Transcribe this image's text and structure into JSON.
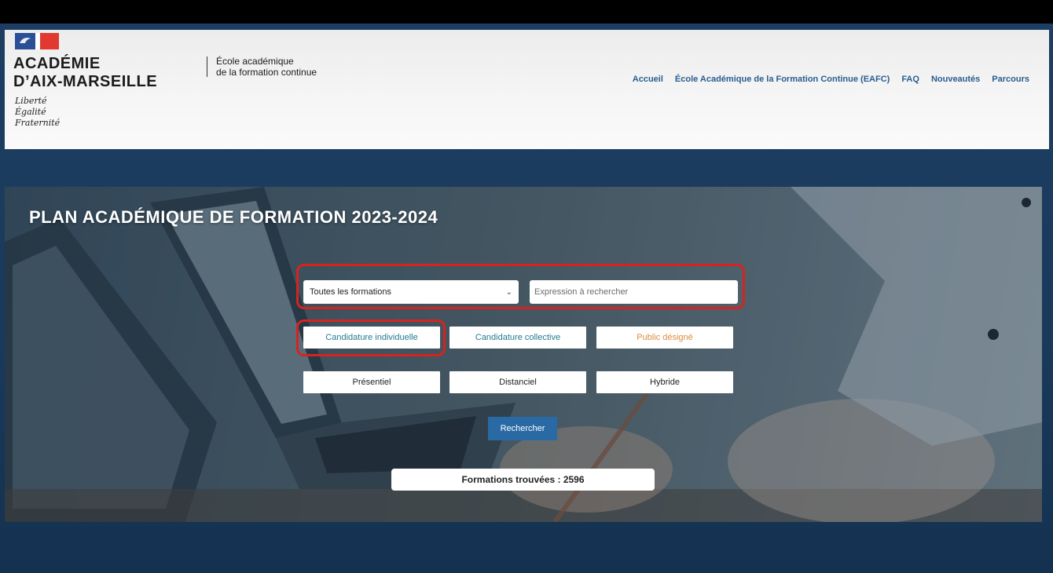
{
  "header": {
    "logo_line1": "ACADÉMIE",
    "logo_line2": "D’AIX-MARSEILLE",
    "motto": [
      "Liberté",
      "Égalité",
      "Fraternité"
    ],
    "school_line1": "École académique",
    "school_line2": "de la formation continue",
    "nav": [
      "Accueil",
      "École Académique de la Formation Continue (EAFC)",
      "FAQ",
      "Nouveautés",
      "Parcours"
    ]
  },
  "hero": {
    "title": "PLAN ACADÉMIQUE DE FORMATION 2023-2024",
    "select_value": "Toutes les formations",
    "search_placeholder": "Expression à rechercher",
    "candidature_buttons": [
      "Candidature individuelle",
      "Candidature collective",
      "Public désigné"
    ],
    "modality_buttons": [
      "Présentiel",
      "Distanciel",
      "Hybride"
    ],
    "search_button": "Rechercher",
    "count_text": "Formations trouvées : 2596"
  },
  "colors": {
    "nav_link": "#2a5d8f",
    "highlight": "#d6231e",
    "teal_text": "#247b93",
    "orange_text": "#e08a3c",
    "search_button": "#2a6aa4"
  }
}
